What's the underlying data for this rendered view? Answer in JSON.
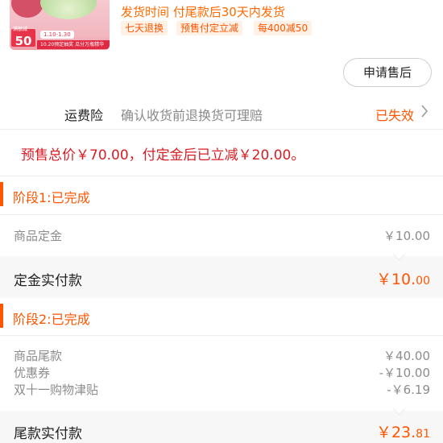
{
  "product": {
    "thumbnail": {
      "badge": "50",
      "badge_prefix": "满额减",
      "date_range": "1.10-1.30",
      "bar_text": "10.20预定抽奖 瓜分万瓶精华",
      "colors": {
        "background": "#f2b7c0",
        "jar_green": "#bcdca0",
        "accent": "#e8344b"
      }
    },
    "shipping_text": "发货时间  付尾款后30天内发货",
    "tags": [
      "七天退换",
      "预售付定立减",
      "每400减50"
    ]
  },
  "after_sale_button": "申请售后",
  "freight_insurance": {
    "label": "运费险",
    "description": "确认收货前退换货可理赔",
    "status": "已失效",
    "chevron_icon": "chevron-right-icon"
  },
  "presale_note": "预售总价￥70.00，付定金后已立减￥20.00。",
  "stage1": {
    "title": "阶段1:已完成",
    "rows": [
      {
        "label": "商品定金",
        "value": "￥10.00"
      }
    ],
    "paid_label": "定金实付款",
    "paid_amount_main": "￥10.",
    "paid_amount_cents": "00"
  },
  "stage2": {
    "title": "阶段2:已完成",
    "rows": [
      {
        "label": "商品尾款",
        "value": "￥40.00"
      },
      {
        "label": "优惠券",
        "value": "-￥10.00"
      },
      {
        "label": "双十一购物津贴",
        "value": "-￥6.19"
      }
    ],
    "paid_label": "尾款实付款",
    "paid_amount_main": "￥23.",
    "paid_amount_cents": "81"
  },
  "theme": {
    "accent": "#ff5500",
    "price_red": "#d91c24"
  }
}
